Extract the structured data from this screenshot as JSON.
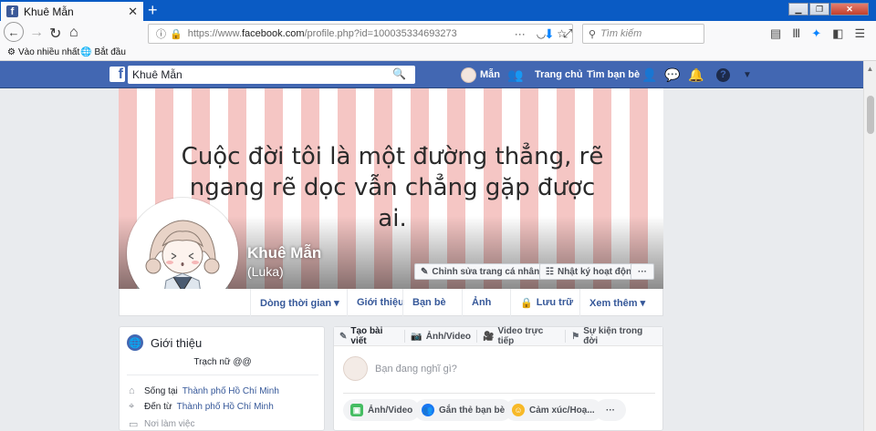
{
  "browser": {
    "tab_title": "Khuê Mẫn",
    "tab_close": "✕",
    "new_tab": "+",
    "url_prefix": "https://www.",
    "url_domain": "facebook.com",
    "url_path": "/profile.php?id=100035334693273",
    "search_placeholder": "Tìm kiếm",
    "bookmarks": [
      "Vào nhiều nhất",
      "Bắt đầu"
    ]
  },
  "facebook": {
    "search_value": "Khuê Mẫn",
    "user_short": "Mẫn",
    "nav_home": "Trang chủ",
    "nav_find_friends": "Tìm bạn bè"
  },
  "profile": {
    "cover_quote": "Cuộc đời tôi là một đường thẳng, rẽ ngang rẽ dọc vẫn chẳng gặp được ai.",
    "name": "Khuê Mẫn",
    "alt_name": "(Luka)",
    "edit_profile": "Chỉnh sửa trang cá nhân",
    "activity_log": "Nhật ký hoạt động",
    "more_dots": "···",
    "tabs": [
      {
        "label": "Dòng thời gian ▾"
      },
      {
        "label": "Giới thiệu"
      },
      {
        "label": "Bạn bè"
      },
      {
        "label": "Ảnh"
      },
      {
        "label": "Lưu trữ"
      },
      {
        "label": "Xem thêm ▾"
      }
    ]
  },
  "intro": {
    "title": "Giới thiệu",
    "bio": "Trạch nữ @@",
    "lives_prefix": "Sống tại",
    "lives_place": "Thành phố Hồ Chí Minh",
    "from_prefix": "Đến từ",
    "from_place": "Thành phố Hồ Chí Minh",
    "workplace": "Nơi làm việc"
  },
  "composer": {
    "tabs": [
      "Tạo bài viết",
      "Ảnh/Video",
      "Video trực tiếp",
      "Sự kiện trong đời"
    ],
    "prompt": "Bạn đang nghĩ gì?",
    "buttons": [
      "Ảnh/Video",
      "Gắn thẻ bạn bè",
      "Cảm xúc/Hoạ...",
      "···"
    ]
  },
  "colors": {
    "fb_blue": "#4267b2",
    "link": "#365899",
    "cover_stripe": "#f5c6c4"
  }
}
